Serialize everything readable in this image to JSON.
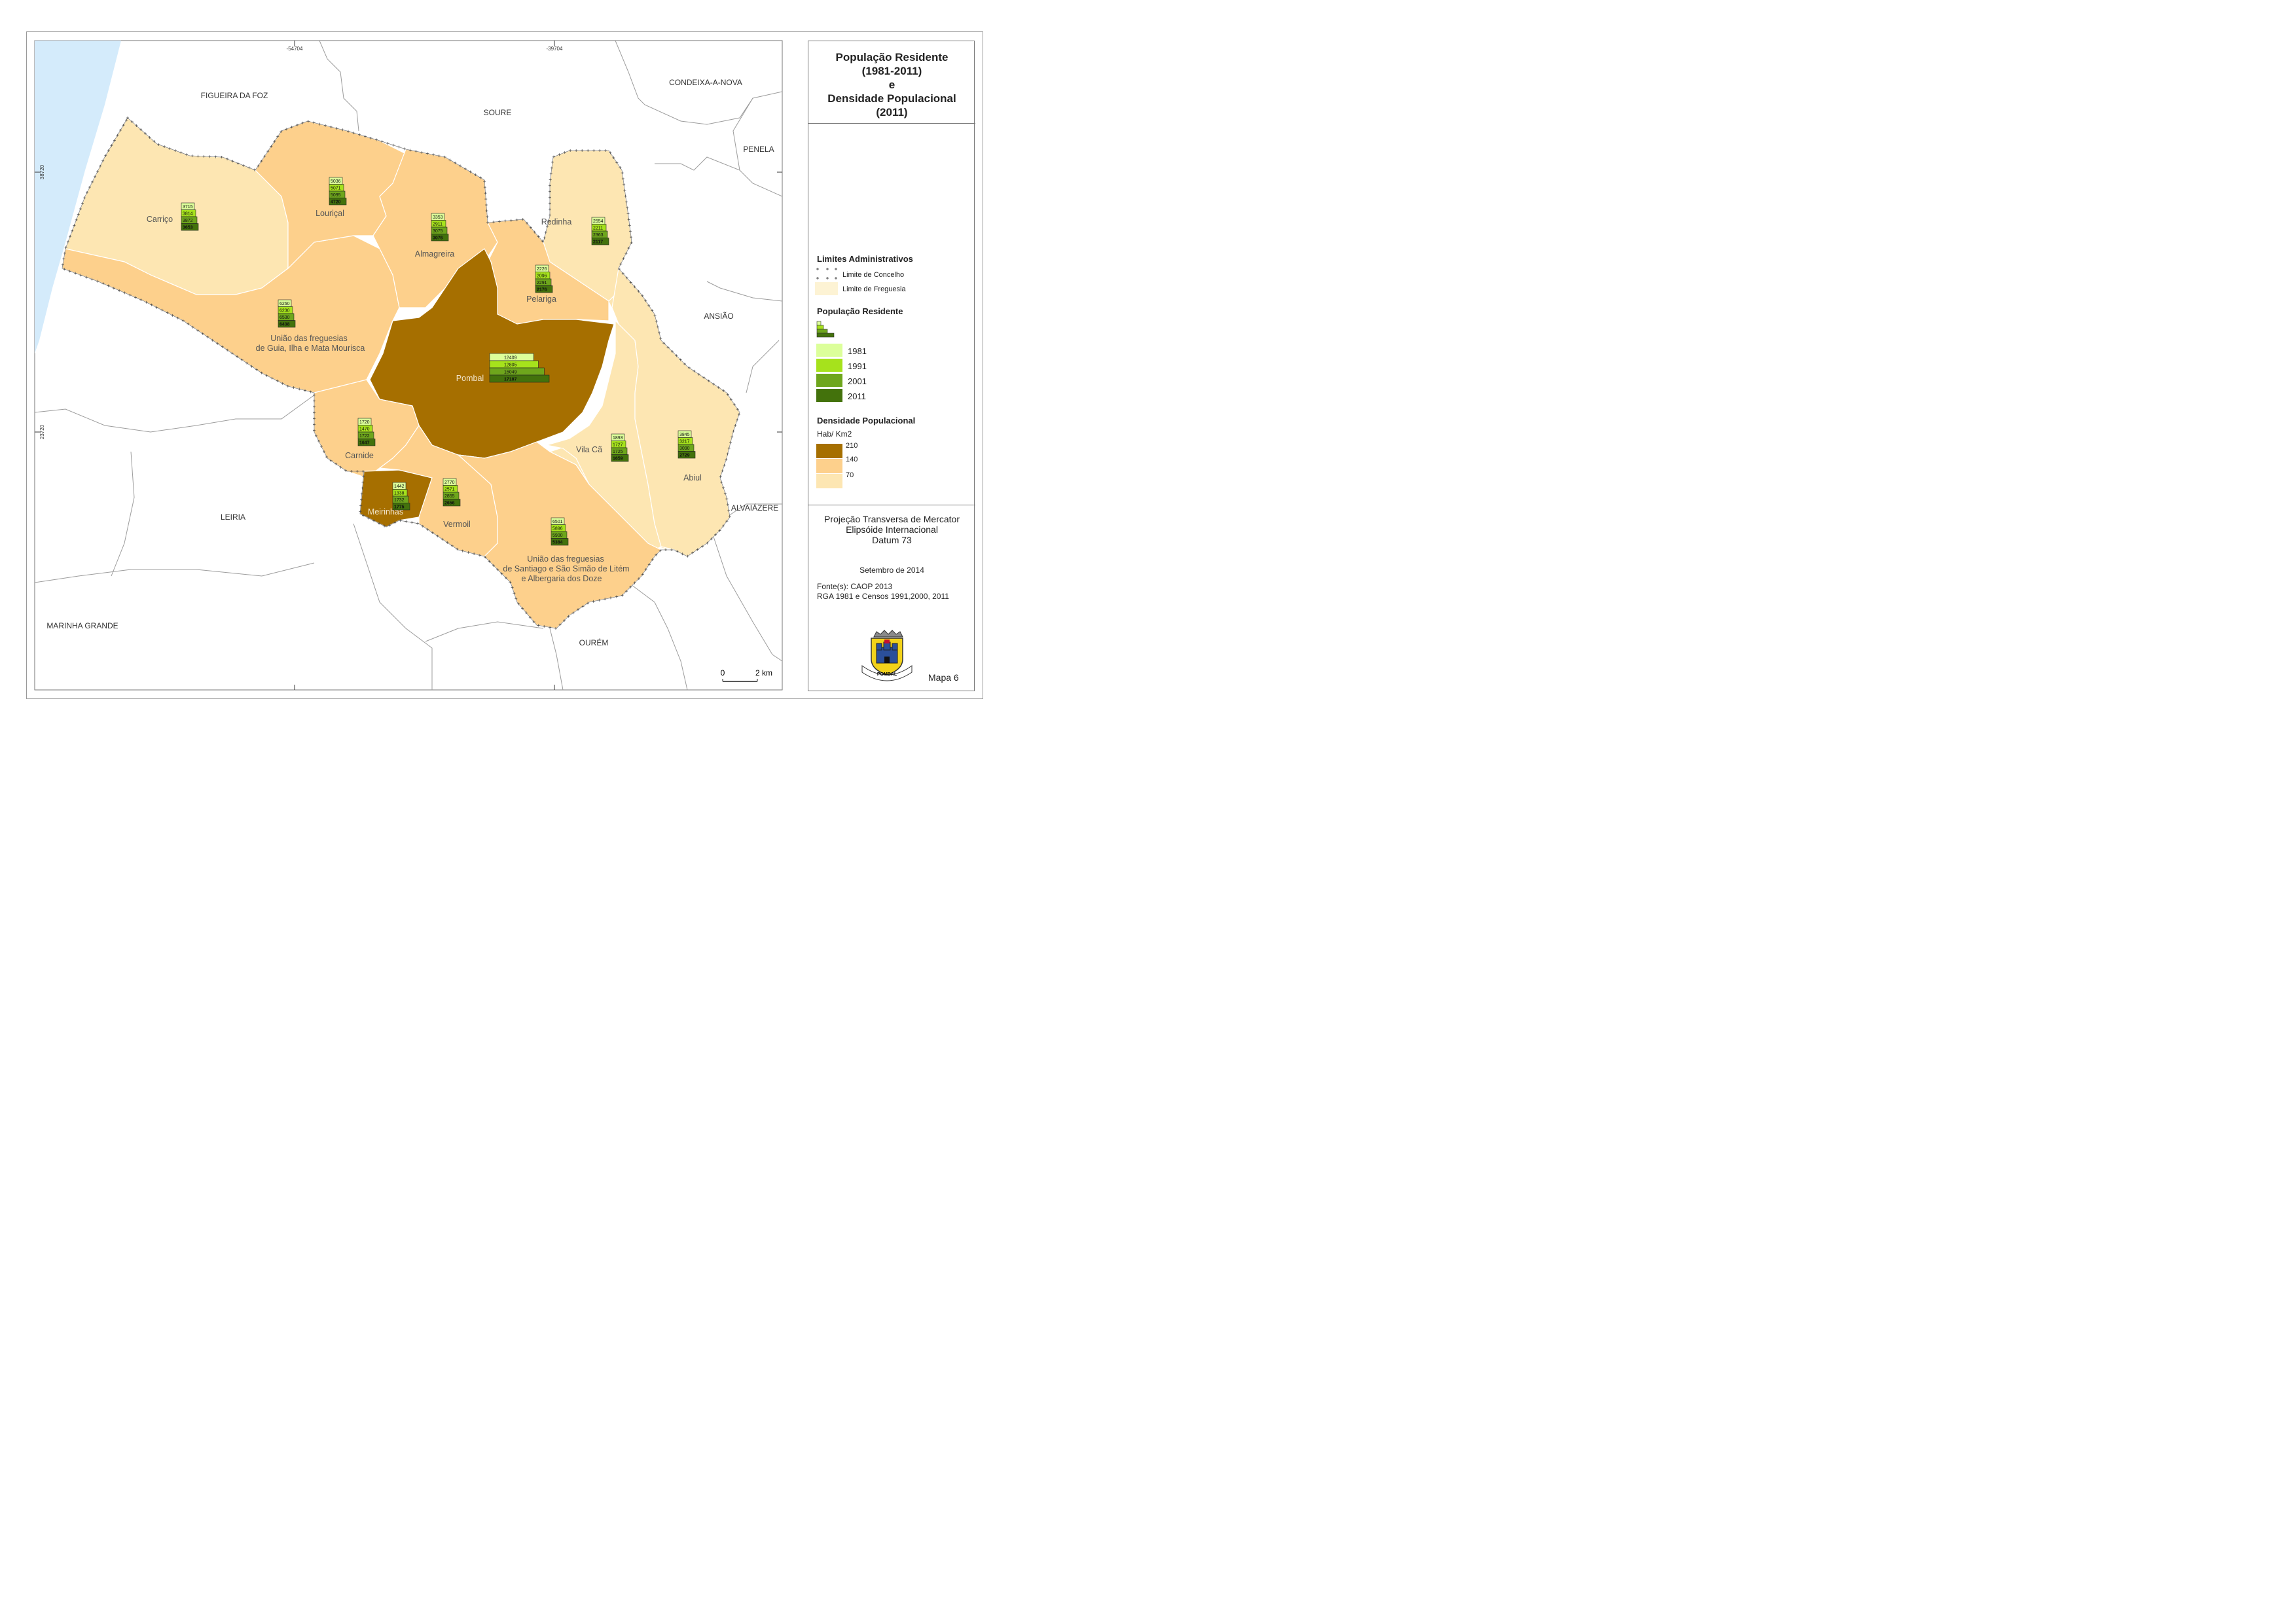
{
  "title": {
    "lines": [
      "População Residente",
      "(1981-2011)",
      "e",
      "Densidade Populacional",
      "(2011)"
    ]
  },
  "grid_labels": {
    "top": [
      "-54704",
      "-39704"
    ],
    "left": [
      "38720",
      "23720"
    ]
  },
  "municipalities": [
    "FIGUEIRA DA FOZ",
    "SOURE",
    "CONDEIXA-A-NOVA",
    "PENELA",
    "ANSIÃO",
    "ALVAIÁZERE",
    "OURÉM",
    "LEIRIA",
    "MARINHA GRANDE"
  ],
  "parishes": [
    {
      "name": "Carriço",
      "density": 70,
      "pop": [
        3715,
        3814,
        3872,
        3653
      ]
    },
    {
      "name": "Louriçal",
      "density": 140,
      "pop": [
        5036,
        5071,
        5095,
        4720
      ]
    },
    {
      "name": "Almagreira",
      "density": 140,
      "pop": [
        3353,
        2911,
        3075,
        3076
      ]
    },
    {
      "name": "Redinha",
      "density": 70,
      "pop": [
        2554,
        2211,
        2363,
        2117
      ]
    },
    {
      "name": "Pelariga",
      "density": 140,
      "pop": [
        2226,
        2096,
        2291,
        2176
      ]
    },
    {
      "name_lines": [
        "União das freguesias",
        "de Guia, Ilha e Mata Mourisca"
      ],
      "density": 140,
      "pop": [
        6260,
        6230,
        6530,
        6438
      ]
    },
    {
      "name": "Pombal",
      "density": 210,
      "pop": [
        12409,
        12805,
        16049,
        17187
      ]
    },
    {
      "name": "Carnide",
      "density": 140,
      "pop": [
        1720,
        1470,
        1722,
        1647
      ]
    },
    {
      "name": "Meirinhas",
      "density": 210,
      "pop": [
        1442,
        1338,
        1732,
        1775
      ]
    },
    {
      "name": "Vermoil",
      "density": 140,
      "pop": [
        2770,
        2571,
        2855,
        2656
      ]
    },
    {
      "name": "Vila Cã",
      "density": 70,
      "pop": [
        1893,
        1727,
        1725,
        1659
      ]
    },
    {
      "name": "Abiul",
      "density": 70,
      "pop": [
        3845,
        3217,
        3090,
        2729
      ]
    },
    {
      "name_lines": [
        "União das freguesias",
        "de Santiago e São Simão de Litém",
        "e Albergaria dos Doze"
      ],
      "density": 140,
      "pop": [
        6501,
        5896,
        5900,
        5384
      ]
    }
  ],
  "legend": {
    "admin_heading": "Limites Administrativos",
    "concelho": "Limite de Concelho",
    "freguesia": "Limite de Freguesia",
    "pop_heading": "População Residente",
    "years": [
      "1981",
      "1991",
      "2001",
      "2011"
    ],
    "year_colors": [
      "#dcff9a",
      "#a6e21c",
      "#6ea61c",
      "#43720c"
    ],
    "density_heading": "Densidade Populacional",
    "density_unit": "Hab/ Km2",
    "density_breaks": [
      "210",
      "140",
      "70"
    ],
    "density_colors": [
      "#a66f00",
      "#fdd08c",
      "#fde6b2"
    ]
  },
  "info": {
    "projection": [
      "Projeção Transversa de Mercator",
      "Elipsóide Internacional",
      "Datum 73"
    ],
    "date": "Setembro de 2014",
    "sources": [
      "Fonte(s): CAOP 2013",
      "RGA 1981 e Censos 1991,2000, 2011"
    ],
    "map_number": "Mapa 6",
    "coat_of_arms_text": "POMBAL"
  },
  "scale_bar": {
    "start": "0",
    "end": "2 km"
  },
  "colors": {
    "sea": "#d4ebfb",
    "land_outside": "#ffffff",
    "boundary": "#9c9c9c"
  }
}
